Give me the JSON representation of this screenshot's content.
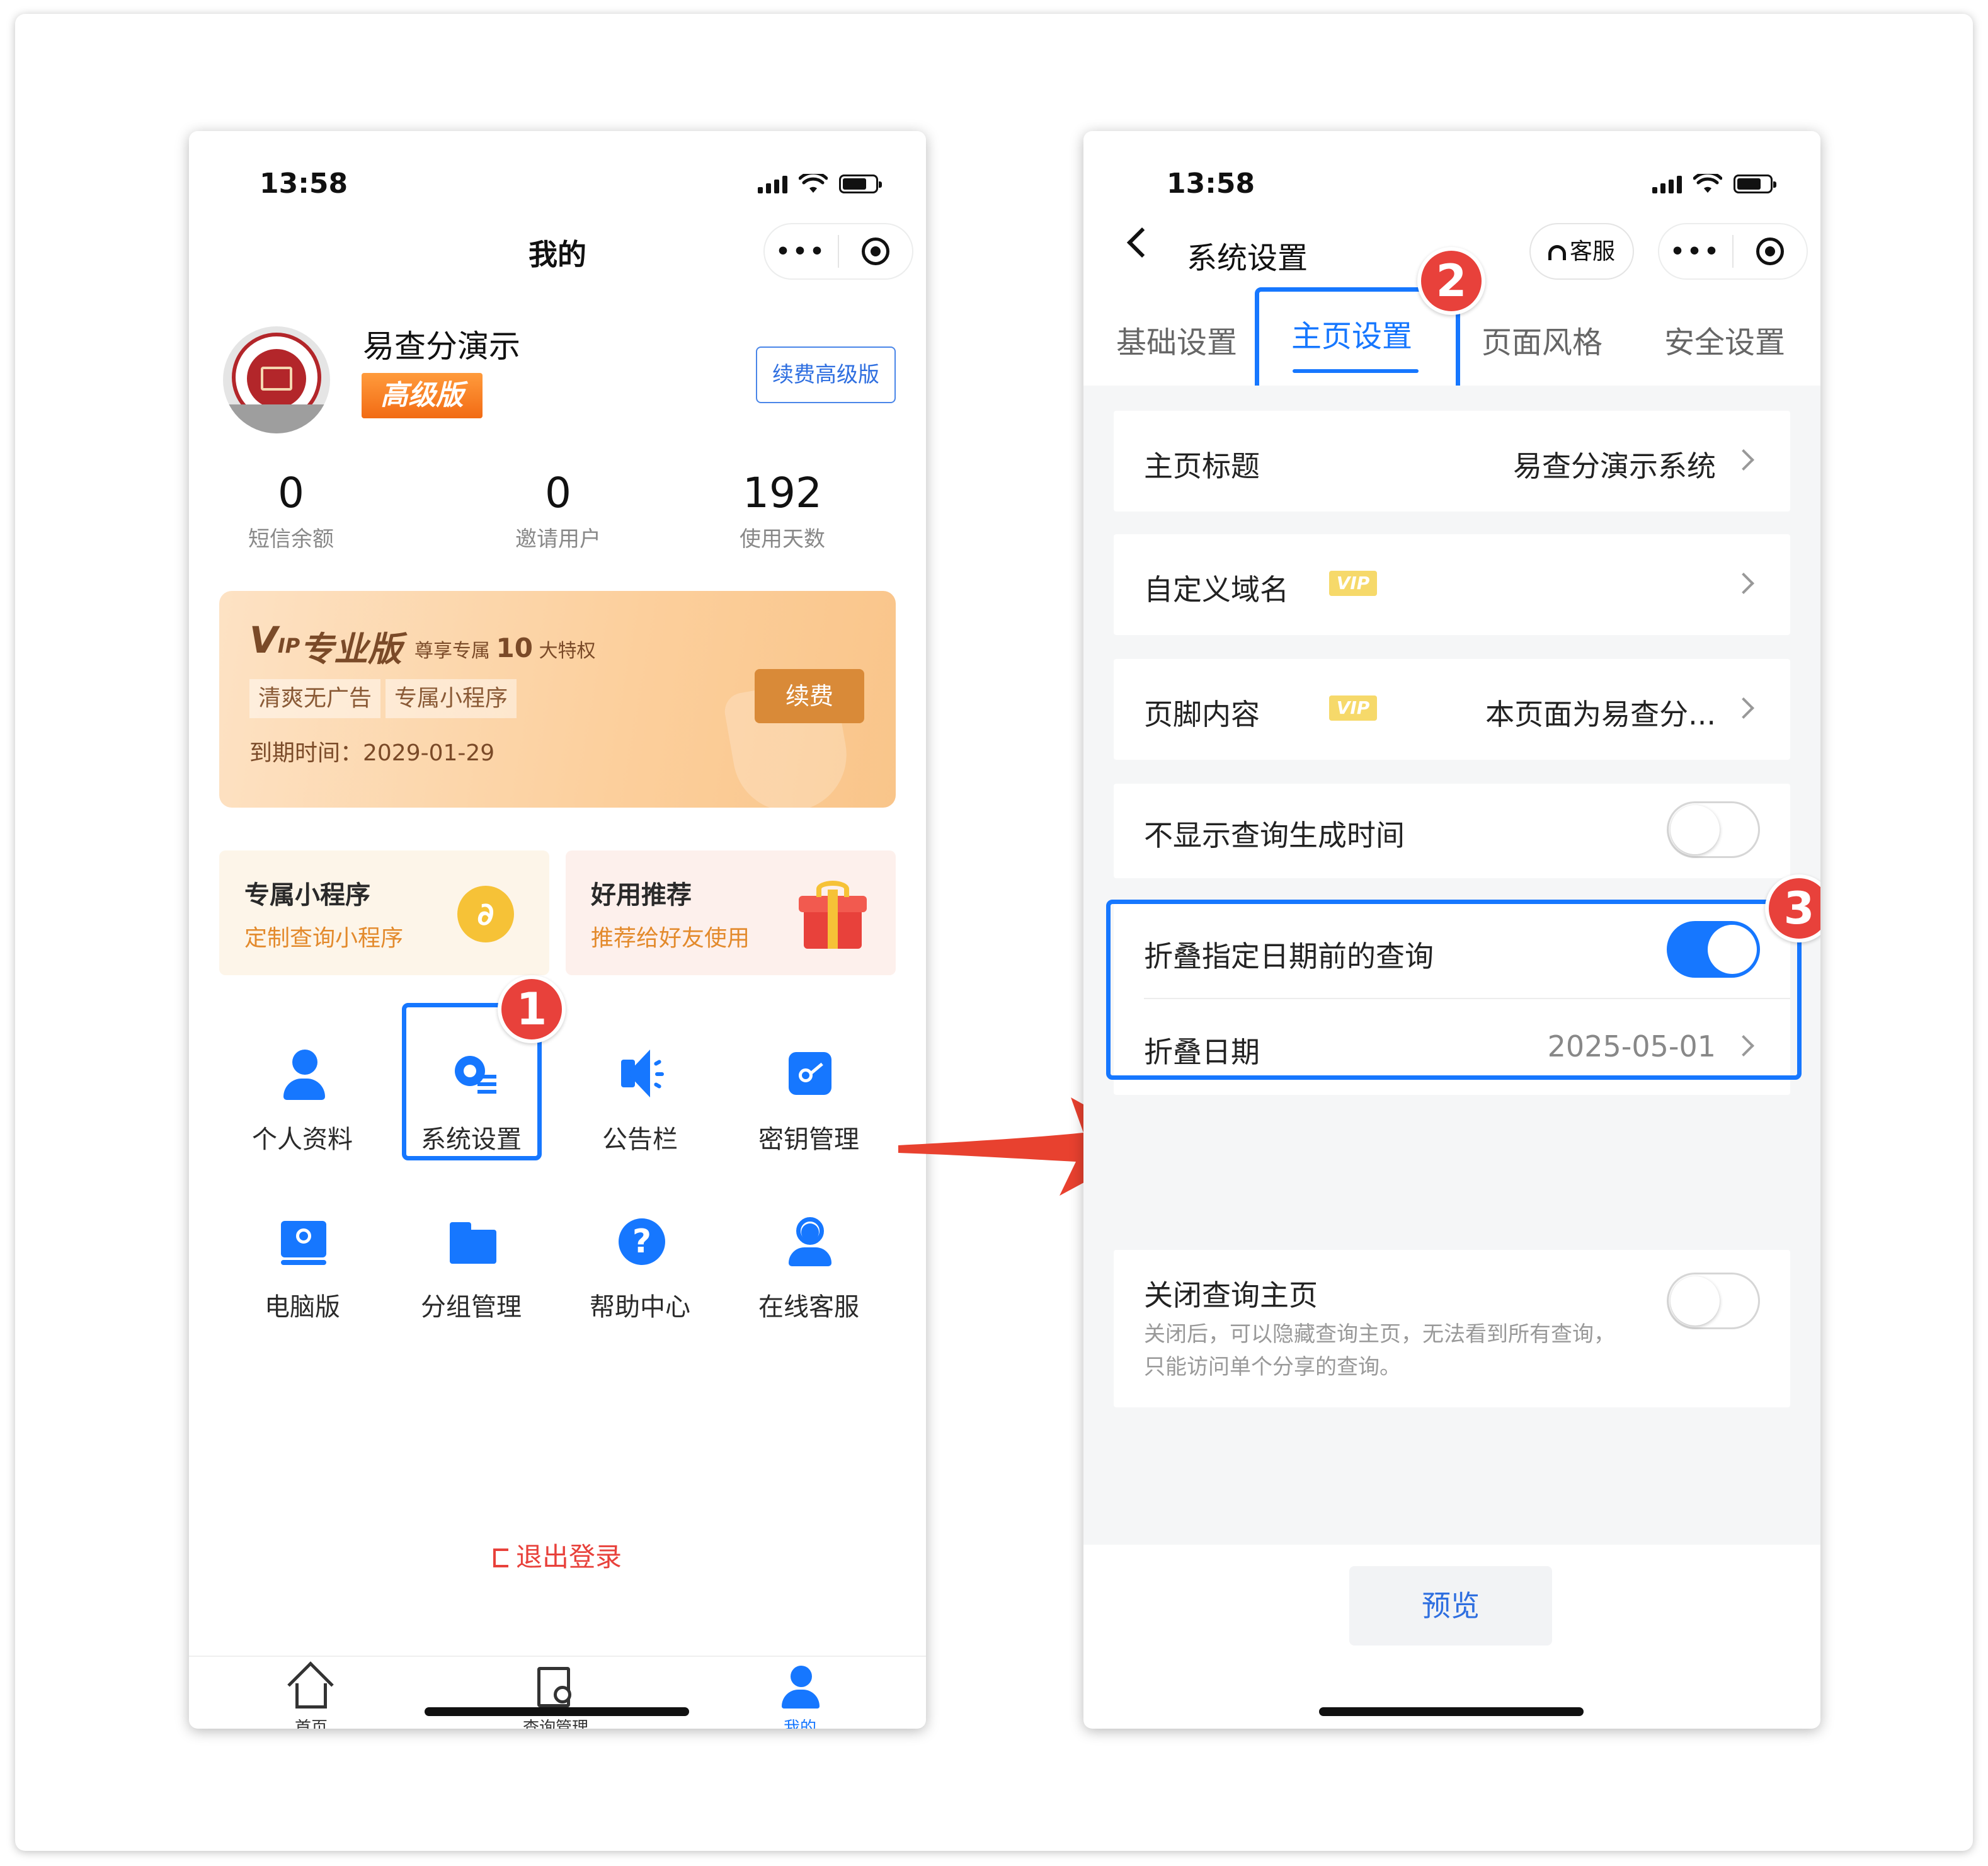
{
  "status": {
    "time": "13:58"
  },
  "left": {
    "nav_title": "我的",
    "user": {
      "name": "易查分演示",
      "tier": "高级版",
      "renew_label": "续费高级版"
    },
    "stats": [
      {
        "value": "0",
        "label": "短信余额"
      },
      {
        "value": "0",
        "label": "邀请用户"
      },
      {
        "value": "192",
        "label": "使用天数"
      }
    ],
    "vip_card": {
      "logo": "V",
      "logo_sub": "IP",
      "tier": "专业版",
      "perk_prefix": "尊享专属",
      "perk_count": "10",
      "perk_suffix": "大特权",
      "tags": [
        "清爽无广告",
        "专属小程序"
      ],
      "expire": "到期时间：2029-01-29",
      "renew": "续费"
    },
    "promos": [
      {
        "title": "专属小程序",
        "subtitle": "定制查询小程序",
        "icon": "mini-program-icon"
      },
      {
        "title": "好用推荐",
        "subtitle": "推荐给好友使用",
        "icon": "gift-icon"
      }
    ],
    "grid": [
      {
        "label": "个人资料",
        "icon": "person-icon"
      },
      {
        "label": "系统设置",
        "icon": "gear-icon"
      },
      {
        "label": "公告栏",
        "icon": "speaker-icon"
      },
      {
        "label": "密钥管理",
        "icon": "key-icon"
      },
      {
        "label": "电脑版",
        "icon": "desktop-icon"
      },
      {
        "label": "分组管理",
        "icon": "folder-icon"
      },
      {
        "label": "帮助中心",
        "icon": "help-icon"
      },
      {
        "label": "在线客服",
        "icon": "customer-service-icon"
      }
    ],
    "logout": "退出登录",
    "tabbar": [
      {
        "label": "首页",
        "icon": "home-icon"
      },
      {
        "label": "查询管理",
        "icon": "query-icon"
      },
      {
        "label": "我的",
        "icon": "me-icon",
        "active": true
      }
    ]
  },
  "right": {
    "title": "系统设置",
    "kefu": "客服",
    "tabs": [
      "基础设置",
      "主页设置",
      "页面风格",
      "安全设置"
    ],
    "active_tab": 1,
    "settings": {
      "home_title": {
        "label": "主页标题",
        "value": "易查分演示系统"
      },
      "custom_domain": {
        "label": "自定义域名",
        "badge": "VIP"
      },
      "footer": {
        "label": "页脚内容",
        "badge": "VIP",
        "value": "本页面为易查分..."
      },
      "hide_time": {
        "label": "不显示查询生成时间",
        "on": false
      },
      "fold_before": {
        "label": "折叠指定日期前的查询",
        "on": true
      },
      "fold_date": {
        "label": "折叠日期",
        "value": "2025-05-01"
      },
      "close_home": {
        "label": "关闭查询主页",
        "desc": "关闭后，可以隐藏查询主页，无法看到所有查询，只能访问单个分享的查询。",
        "on": false
      }
    },
    "preview": "预览"
  },
  "annotations": [
    "1",
    "2",
    "3"
  ],
  "colors": {
    "accent": "#1677ff",
    "badge": "#e8413b",
    "vip_orange": "#f26b14"
  }
}
